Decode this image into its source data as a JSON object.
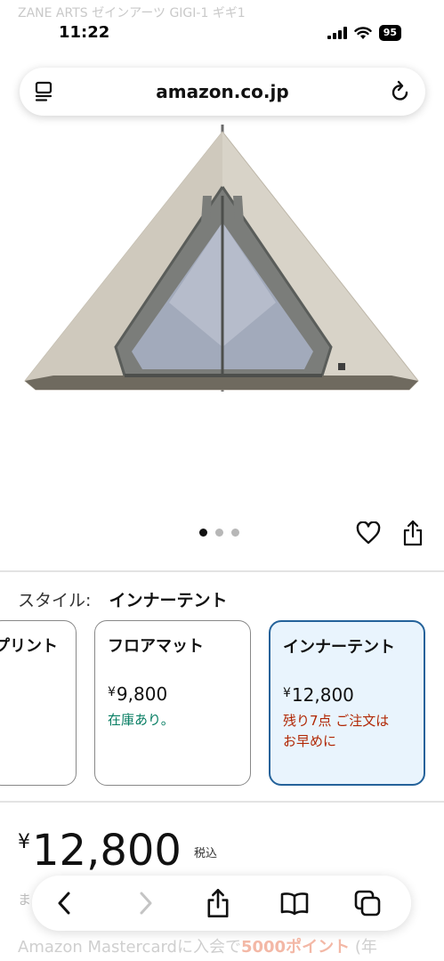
{
  "page": {
    "ghost_title": "ZANE ARTS ゼインアーツ GIGI-1 ギギ1"
  },
  "status_bar": {
    "time": "11:22",
    "battery": "95",
    "icons": [
      "signal-icon",
      "wifi-icon",
      "battery-icon"
    ]
  },
  "address_bar": {
    "url": "amazon.co.jp",
    "left_icon": "reader-icon",
    "right_icon": "reload-icon"
  },
  "gallery": {
    "dots_count": 3,
    "active_dot": 1,
    "favorite_icon": "heart-icon",
    "share_icon": "share-icon"
  },
  "style_selector": {
    "label": "スタイル:",
    "selected": "インナーテント",
    "options": [
      {
        "name": "プリント",
        "price_symbol": "",
        "price": "",
        "stock": ""
      },
      {
        "name": "フロアマット",
        "price_symbol": "¥",
        "price": "9,800",
        "stock": "在庫あり。",
        "stock_color": "#067d62"
      },
      {
        "name": "インナーテント",
        "price_symbol": "¥",
        "price": "12,800",
        "stock_line1": "残り7点 ご注文は",
        "stock_line2": "お早めに",
        "stock_color": "#b12704",
        "selected": true
      }
    ]
  },
  "price": {
    "symbol": "¥",
    "amount": "12,800",
    "tax_label": "税込"
  },
  "toolbar": {
    "peek_text": "ま",
    "buttons": [
      "back-icon",
      "forward-icon",
      "share-icon",
      "bookmarks-icon",
      "tabs-icon"
    ]
  },
  "promo": {
    "prefix": "Amazon Mastercardに入会で",
    "highlight": "5000ポイント",
    "suffix": " (年"
  },
  "colors": {
    "accent_border": "#24629a",
    "selected_bg": "#e9f4fd",
    "in_stock": "#067d62",
    "low_stock": "#b12704"
  }
}
